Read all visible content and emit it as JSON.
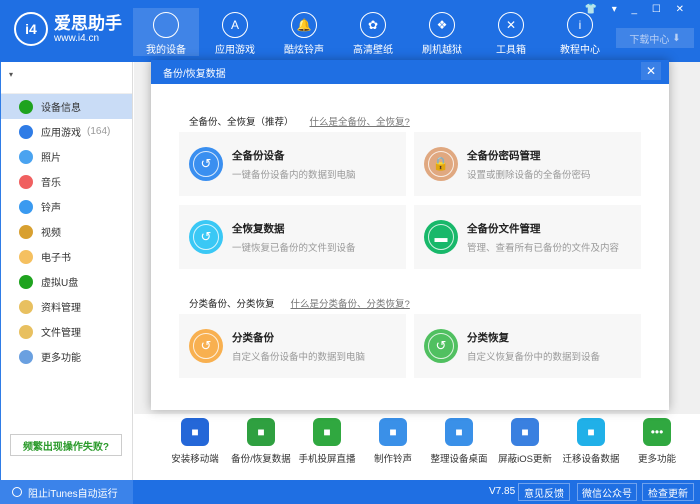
{
  "app": {
    "name": "爱思助手",
    "url": "www.i4.cn",
    "logo_text": "i4"
  },
  "nav": [
    {
      "label": "我的设备",
      "icon": "apple-icon",
      "active": true
    },
    {
      "label": "应用游戏",
      "icon": "app-store-icon"
    },
    {
      "label": "酷炫铃声",
      "icon": "bell-icon"
    },
    {
      "label": "高清壁纸",
      "icon": "flower-icon"
    },
    {
      "label": "刷机越狱",
      "icon": "dropbox-icon"
    },
    {
      "label": "工具箱",
      "icon": "tools-icon"
    },
    {
      "label": "教程中心",
      "icon": "info-icon"
    }
  ],
  "window_controls": [
    "shirt-icon",
    "menu-icon",
    "minimize-icon",
    "maximize-icon",
    "close-icon"
  ],
  "download_center": "下载中心",
  "sidebar": {
    "items": [
      {
        "label": "设备信息",
        "color": "#1fa31f",
        "active": true
      },
      {
        "label": "应用游戏",
        "count": "(164)",
        "color": "#2f7ce6"
      },
      {
        "label": "照片",
        "color": "#4aa3f0"
      },
      {
        "label": "音乐",
        "color": "#f06060"
      },
      {
        "label": "铃声",
        "color": "#3a9af0"
      },
      {
        "label": "视频",
        "color": "#d8a030"
      },
      {
        "label": "电子书",
        "color": "#f5c060"
      },
      {
        "label": "虚拟U盘",
        "color": "#1fa31f"
      },
      {
        "label": "资料管理",
        "color": "#e8c060"
      },
      {
        "label": "文件管理",
        "color": "#e8c060"
      },
      {
        "label": "更多功能",
        "color": "#6aa0e0"
      }
    ],
    "fail_link": "频繁出现操作失败?"
  },
  "modal": {
    "title": "备份/恢复数据",
    "section1": {
      "title": "全备份、全恢复（推荐）",
      "link": "什么是全备份、全恢复?"
    },
    "section2": {
      "title": "分类备份、分类恢复",
      "link": "什么是分类备份、分类恢复?"
    },
    "cards": [
      {
        "title": "全备份设备",
        "desc": "一键备份设备内的数据到电脑",
        "color": "#3a8ff0",
        "icon": "backup-clock-icon"
      },
      {
        "title": "全备份密码管理",
        "desc": "设置或删除设备的全备份密码",
        "color": "#e0a880",
        "icon": "lock-icon"
      },
      {
        "title": "全恢复数据",
        "desc": "一键恢复已备份的文件到设备",
        "color": "#3ac8f5",
        "icon": "restore-clock-icon"
      },
      {
        "title": "全备份文件管理",
        "desc": "管理、查看所有已备份的文件及内容",
        "color": "#18b86a",
        "icon": "folder-icon"
      },
      {
        "title": "分类备份",
        "desc": "自定义备份设备中的数据到电脑",
        "color": "#f8b050",
        "icon": "category-backup-icon"
      },
      {
        "title": "分类恢复",
        "desc": "自定义恢复备份中的数据到设备",
        "color": "#50c060",
        "icon": "category-restore-icon"
      }
    ]
  },
  "tools": [
    {
      "label": "安装移动端",
      "color": "#2467d8"
    },
    {
      "label": "备份/恢复数据",
      "color": "#2fa040"
    },
    {
      "label": "手机投屏直播",
      "color": "#30a840"
    },
    {
      "label": "制作铃声",
      "color": "#3a90e8"
    },
    {
      "label": "整理设备桌面",
      "color": "#3a90e8"
    },
    {
      "label": "屏蔽iOS更新",
      "color": "#3a80e0"
    },
    {
      "label": "迁移设备数据",
      "color": "#20b0e8"
    },
    {
      "label": "更多功能",
      "color": "#30a840"
    }
  ],
  "status": {
    "itunes": "阻止iTunes自动运行",
    "version": "V7.85",
    "feedback": "意见反馈",
    "wechat": "微信公众号",
    "update": "检查更新"
  }
}
